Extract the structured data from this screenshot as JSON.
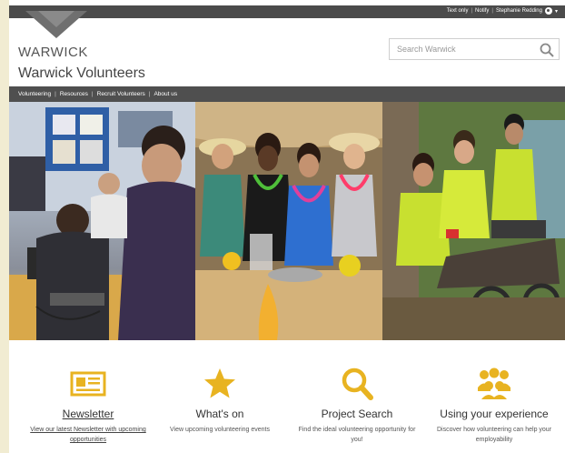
{
  "colors": {
    "topbar": "#4b4b4b",
    "nav": "#4f4f4f",
    "accent_gold": "#e8b321",
    "logo_grey": "#555555"
  },
  "topbar": {
    "text_only": "Text only",
    "notify": "Notify",
    "user_name": "Stephanie Redding",
    "separator": "|"
  },
  "header": {
    "logo_text": "WARWICK",
    "site_title": "Warwick Volunteers"
  },
  "search": {
    "placeholder": "Search Warwick",
    "icon": "search-icon"
  },
  "nav": {
    "items": [
      {
        "label": "Volunteering"
      },
      {
        "label": "Resources"
      },
      {
        "label": "Recruit Volunteers"
      },
      {
        "label": "About us"
      }
    ],
    "separator": "|"
  },
  "features": [
    {
      "title": "Newsletter",
      "description": "View our latest Newsletter with upcoming opportunities",
      "icon": "newspaper-icon"
    },
    {
      "title": "What's on",
      "description": "View upcoming volunteering events",
      "icon": "star-icon"
    },
    {
      "title": "Project Search",
      "description": "Find the ideal volunteering opportunity for you!",
      "icon": "magnifier-icon"
    },
    {
      "title": "Using your experience",
      "description": "Discover how volunteering can help your employability",
      "icon": "people-icon"
    }
  ]
}
